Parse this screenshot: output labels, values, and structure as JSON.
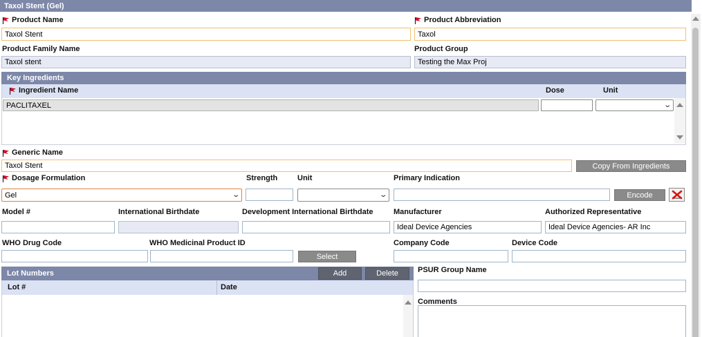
{
  "title": "Taxol Stent (Gel)",
  "product_name": {
    "label": "Product Name",
    "value": "Taxol Stent"
  },
  "product_abbreviation": {
    "label": "Product Abbreviation",
    "value": "Taxol"
  },
  "product_family_name": {
    "label": "Product Family Name",
    "value": "Taxol stent"
  },
  "product_group": {
    "label": "Product Group",
    "value": "Testing the Max Proj"
  },
  "key_ingredients": {
    "title": "Key Ingredients",
    "columns": {
      "ingredient": "Ingredient Name",
      "dose": "Dose",
      "unit": "Unit"
    },
    "rows": [
      {
        "ingredient": "PACLITAXEL",
        "dose": "",
        "unit": ""
      }
    ]
  },
  "generic_name": {
    "label": "Generic Name",
    "value": "Taxol Stent"
  },
  "copy_from_ingredients": "Copy From Ingredients",
  "dosage_formulation": {
    "label": "Dosage Formulation",
    "value": "Gel"
  },
  "strength": {
    "label": "Strength",
    "value": ""
  },
  "unit": {
    "label": "Unit",
    "value": ""
  },
  "primary_indication": {
    "label": "Primary Indication",
    "value": ""
  },
  "encode_button": "Encode",
  "model": {
    "label": "Model #",
    "value": ""
  },
  "international_birthdate": {
    "label": "International Birthdate",
    "value": ""
  },
  "development_international_birthdate": {
    "label": "Development International Birthdate",
    "value": ""
  },
  "manufacturer": {
    "label": "Manufacturer",
    "value": "Ideal Device Agencies"
  },
  "authorized_representative": {
    "label": "Authorized Representative",
    "value": "Ideal Device Agencies- AR Inc"
  },
  "who_drug_code": {
    "label": "WHO Drug Code",
    "value": ""
  },
  "who_medicinal_product_id": {
    "label": "WHO Medicinal Product ID",
    "value": ""
  },
  "select_button": "Select",
  "company_code": {
    "label": "Company Code",
    "value": ""
  },
  "device_code": {
    "label": "Device Code",
    "value": ""
  },
  "lot_numbers": {
    "title": "Lot Numbers",
    "add": "Add",
    "delete": "Delete",
    "columns": {
      "lot": "Lot #",
      "date": "Date"
    }
  },
  "psur_group_name": {
    "label": "PSUR Group Name",
    "value": ""
  },
  "comments": {
    "label": "Comments",
    "value": ""
  },
  "icons": {
    "required": "red-flag-icon",
    "clear": "red-x-icon",
    "select_arrow": "chevron-down-icon"
  }
}
